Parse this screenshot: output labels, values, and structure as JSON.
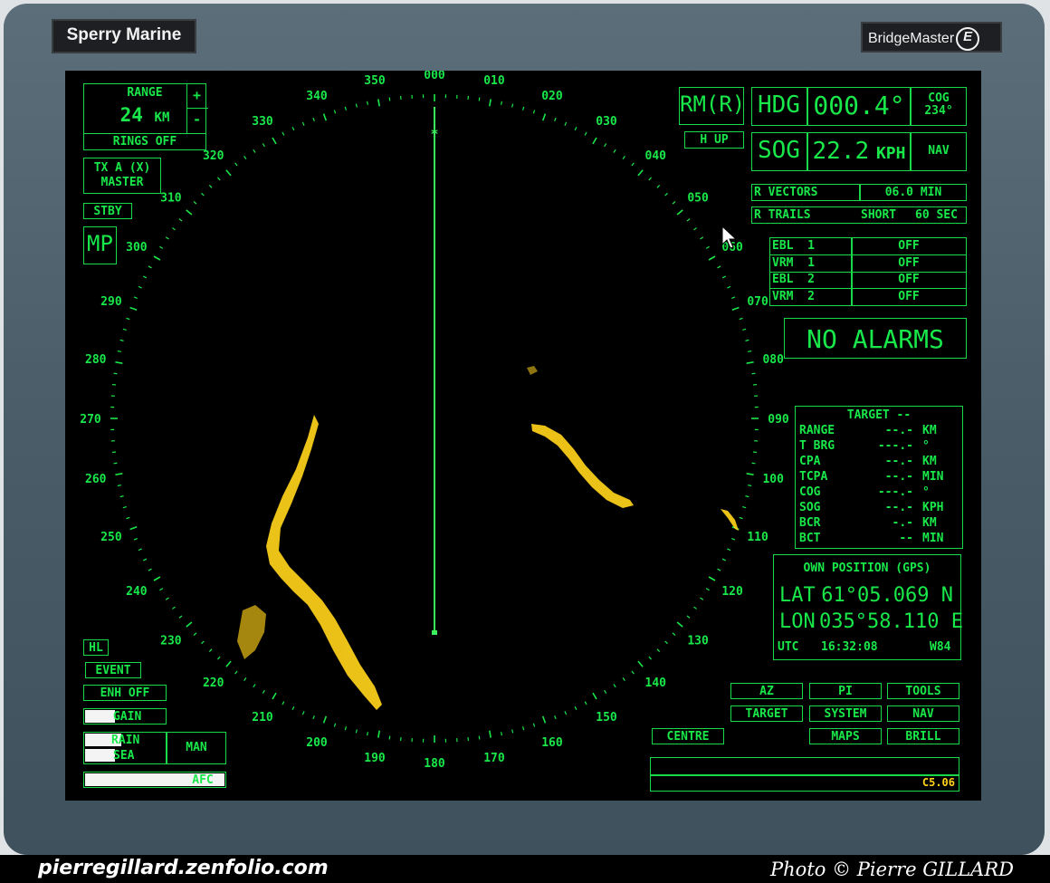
{
  "bezel": {
    "brand_left": "Sperry Marine",
    "brand_right": "BridgeMaster",
    "brand_logo": "E"
  },
  "range": {
    "title": "RANGE",
    "value": "24",
    "unit": "KM",
    "plus": "+",
    "minus": "-",
    "rings": "RINGS OFF"
  },
  "tx": {
    "line1": "TX A (X)",
    "line2": "MASTER"
  },
  "stby": "STBY",
  "mp": "MP",
  "mode": {
    "motion": "RM(R)",
    "orientation": "H UP"
  },
  "heading": {
    "label": "HDG",
    "value": "000.4°",
    "cog_label": "COG",
    "cog_value": "234°"
  },
  "speed": {
    "label": "SOG",
    "value": "22.2",
    "unit": "KPH",
    "source": "NAV"
  },
  "vectors": {
    "label": "R VECTORS",
    "value": "06.0 MIN"
  },
  "trails": {
    "label": "R TRAILS",
    "mode": "SHORT",
    "value": "60 SEC"
  },
  "markers": [
    {
      "name": "EBL  1",
      "state": "OFF"
    },
    {
      "name": "VRM  1",
      "state": "OFF"
    },
    {
      "name": "EBL  2",
      "state": "OFF"
    },
    {
      "name": "VRM  2",
      "state": "OFF"
    }
  ],
  "alarms": "NO ALARMS",
  "target": {
    "title": "TARGET --",
    "rows": [
      {
        "label": "RANGE",
        "value": "--.-",
        "unit": "KM"
      },
      {
        "label": "T BRG",
        "value": "---.-",
        "unit": "°"
      },
      {
        "label": "CPA",
        "value": "--.-",
        "unit": "KM"
      },
      {
        "label": "TCPA",
        "value": "--.-",
        "unit": "MIN"
      },
      {
        "label": "COG",
        "value": "---.-",
        "unit": "°"
      },
      {
        "label": "SOG",
        "value": "--.-",
        "unit": "KPH"
      },
      {
        "label": "BCR",
        "value": "-.-",
        "unit": "KM"
      },
      {
        "label": "BCT",
        "value": "--",
        "unit": "MIN"
      }
    ]
  },
  "position": {
    "title": "OWN POSITION (GPS)",
    "lat_label": "LAT",
    "lat": "61°05.069 N",
    "lon_label": "LON",
    "lon": "035°58.110 E",
    "utc_label": "UTC",
    "time": "16:32:08",
    "datum": "W84"
  },
  "left_controls": {
    "hl": "HL",
    "event": "EVENT",
    "enh": "ENH OFF",
    "gain": "GAIN",
    "rain": "RAIN",
    "sea": "SEA",
    "man": "MAN",
    "afc": "AFC"
  },
  "levels": {
    "gain": 0.38,
    "rain": 0.45,
    "sea": 0.38,
    "afc": 1.0
  },
  "menu": {
    "az": "AZ",
    "pi": "PI",
    "tools": "TOOLS",
    "target": "TARGET",
    "system": "SYSTEM",
    "nav": "NAV",
    "centre": "CENTRE",
    "maps": "MAPS",
    "brill": "BRILL"
  },
  "version": "C5.06",
  "bearing_labels": [
    "000",
    "010",
    "020",
    "030",
    "040",
    "050",
    "060",
    "070",
    "080",
    "090",
    "100",
    "110",
    "120",
    "130",
    "140",
    "150",
    "160",
    "170",
    "180",
    "190",
    "200",
    "210",
    "220",
    "230",
    "240",
    "250",
    "260",
    "270",
    "280",
    "290",
    "300",
    "310",
    "320",
    "330",
    "340",
    "350"
  ],
  "footer": {
    "site": "pierregillard.zenfolio.com",
    "credit": "Photo © Pierre GILLARD"
  },
  "colors": {
    "phosphor": "#19e84a",
    "echo": "#ffd21a",
    "screen": "#000000",
    "bezel": "#4f616d"
  }
}
